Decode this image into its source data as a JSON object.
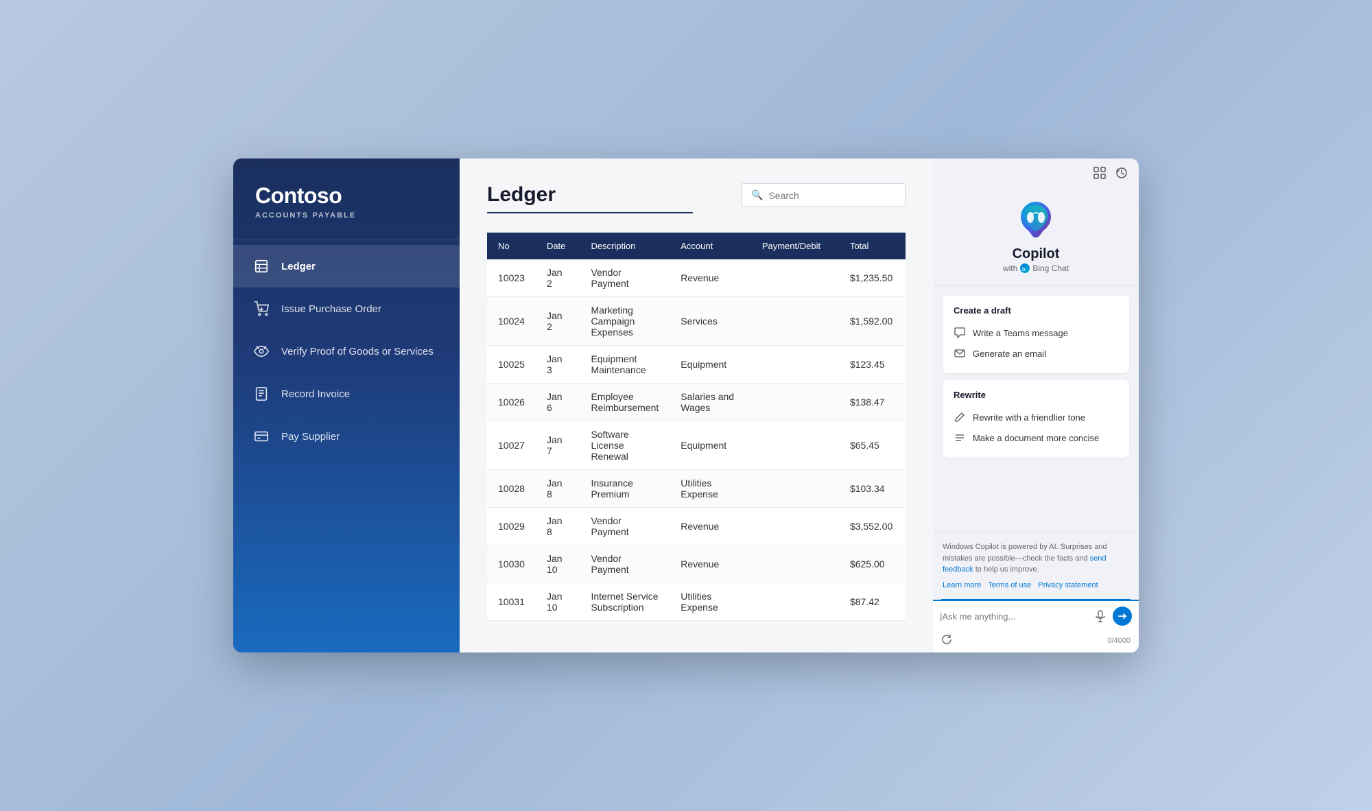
{
  "sidebar": {
    "logo": "Contoso",
    "subtitle": "ACCOUNTS PAYABLE",
    "nav_items": [
      {
        "id": "ledger",
        "label": "Ledger",
        "active": true,
        "icon": "ledger"
      },
      {
        "id": "issue-po",
        "label": "Issue Purchase Order",
        "active": false,
        "icon": "cart"
      },
      {
        "id": "verify-goods",
        "label": "Verify Proof of Goods or Services",
        "active": false,
        "icon": "eye"
      },
      {
        "id": "record-invoice",
        "label": "Record Invoice",
        "active": false,
        "icon": "invoice"
      },
      {
        "id": "pay-supplier",
        "label": "Pay Supplier",
        "active": false,
        "icon": "payment"
      }
    ]
  },
  "main": {
    "page_title": "Ledger",
    "search_placeholder": "Search",
    "table": {
      "columns": [
        "No",
        "Date",
        "Description",
        "Account",
        "Payment/Debit",
        "Total"
      ],
      "rows": [
        {
          "no": "10023",
          "date": "Jan 2",
          "description": "Vendor Payment",
          "account": "Revenue",
          "payment_debit": "",
          "total": "$1,235.50"
        },
        {
          "no": "10024",
          "date": "Jan 2",
          "description": "Marketing Campaign Expenses",
          "account": "Services",
          "payment_debit": "",
          "total": "$1,592.00"
        },
        {
          "no": "10025",
          "date": "Jan 3",
          "description": "Equipment Maintenance",
          "account": "Equipment",
          "payment_debit": "",
          "total": "$123.45"
        },
        {
          "no": "10026",
          "date": "Jan 6",
          "description": "Employee Reimbursement",
          "account": "Salaries and Wages",
          "payment_debit": "",
          "total": "$138.47"
        },
        {
          "no": "10027",
          "date": "Jan 7",
          "description": "Software License Renewal",
          "account": "Equipment",
          "payment_debit": "",
          "total": "$65.45"
        },
        {
          "no": "10028",
          "date": "Jan 8",
          "description": "Insurance Premium",
          "account": "Utilities Expense",
          "payment_debit": "",
          "total": "$103.34"
        },
        {
          "no": "10029",
          "date": "Jan 8",
          "description": "Vendor Payment",
          "account": "Revenue",
          "payment_debit": "",
          "total": "$3,552.00"
        },
        {
          "no": "10030",
          "date": "Jan 10",
          "description": "Vendor Payment",
          "account": "Revenue",
          "payment_debit": "",
          "total": "$625.00"
        },
        {
          "no": "10031",
          "date": "Jan 10",
          "description": "Internet Service Subscription",
          "account": "Utilities Expense",
          "payment_debit": "",
          "total": "$87.42"
        }
      ]
    }
  },
  "copilot": {
    "name": "Copilot",
    "with_text": "with",
    "bing_chat_text": "Bing Chat",
    "sections": [
      {
        "title": "Create a draft",
        "actions": [
          {
            "id": "teams-message",
            "label": "Write a Teams message",
            "icon": "chat"
          },
          {
            "id": "generate-email",
            "label": "Generate an email",
            "icon": "email"
          }
        ]
      },
      {
        "title": "Rewrite",
        "actions": [
          {
            "id": "friendlier-tone",
            "label": "Rewrite with a friendlier tone",
            "icon": "edit"
          },
          {
            "id": "more-concise",
            "label": "Make a document more concise",
            "icon": "list"
          }
        ]
      }
    ],
    "footer_text": "Windows Copilot is powered by AI. Surprises and mistakes are possible—check the facts and",
    "feedback_link_text": "send feedback",
    "footer_text2": "to help us improve.",
    "links": [
      {
        "label": "Learn more",
        "href": "#"
      },
      {
        "label": "Terms of use",
        "href": "#"
      },
      {
        "label": "Privacy statement",
        "href": "#"
      }
    ],
    "input_placeholder": "|Ask me anything...",
    "char_count": "0/4000"
  }
}
